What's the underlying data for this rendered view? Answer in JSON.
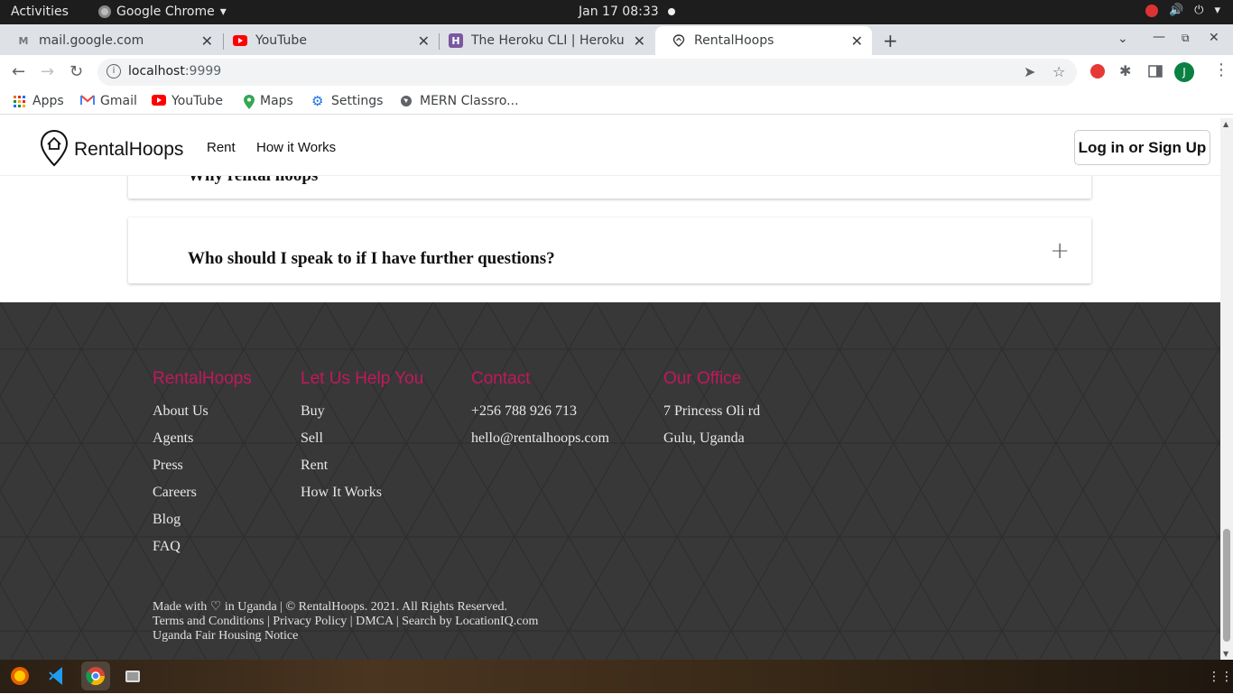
{
  "system": {
    "activities": "Activities",
    "app_name": "Google Chrome",
    "clock": "Jan 17  08:33"
  },
  "tabs": [
    {
      "title": "mail.google.com"
    },
    {
      "title": "YouTube"
    },
    {
      "title": "The Heroku CLI | Heroku D"
    },
    {
      "title": "RentalHoops"
    }
  ],
  "address": {
    "host": "localhost",
    "port": ":9999"
  },
  "profile": {
    "initial": "J"
  },
  "bookmarks": [
    {
      "label": "Apps"
    },
    {
      "label": "Gmail"
    },
    {
      "label": "YouTube"
    },
    {
      "label": "Maps"
    },
    {
      "label": "Settings"
    },
    {
      "label": "MERN Classro..."
    }
  ],
  "site": {
    "brand": "RentalHoops",
    "nav": {
      "rent": "Rent",
      "how": "How it Works"
    },
    "login": "Log in or Sign Up"
  },
  "faq": [
    {
      "question": "Why rental hoops"
    },
    {
      "question": "Who should I speak to if I have further questions?"
    }
  ],
  "footer": {
    "col1": {
      "title": "RentalHoops",
      "links": [
        "About Us",
        "Agents",
        "Press",
        "Careers",
        "Blog",
        "FAQ"
      ]
    },
    "col2": {
      "title": "Let Us Help You",
      "links": [
        "Buy",
        "Sell",
        "Rent",
        "How It Works"
      ]
    },
    "col3": {
      "title": "Contact",
      "phone": "+256 788 926 713",
      "email": "hello@rentalhoops.com"
    },
    "col4": {
      "title": "Our Office",
      "line1": "7 Princess Oli rd",
      "line2": "Gulu, Uganda"
    },
    "bottom": {
      "line1": "Made with ♡ in Uganda | © RentalHoops. 2021. All Rights Reserved.",
      "line2": "Terms and Conditions | Privacy Policy | DMCA | Search by LocationIQ.com",
      "line3": "Uganda Fair Housing Notice"
    }
  },
  "colors": {
    "accent": "#c2185b",
    "footer_bg": "#383838"
  }
}
